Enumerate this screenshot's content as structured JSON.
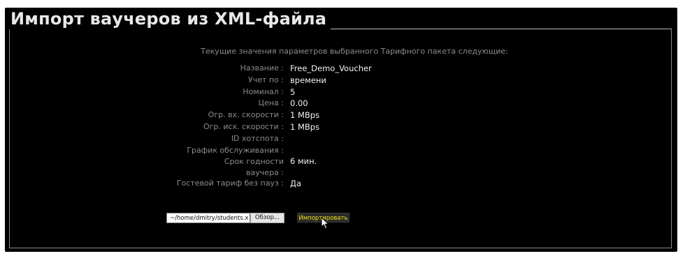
{
  "legend": "Импорт ваучеров из XML-файла",
  "intro": "Текущие значения параметров выбранного Тарифного пакета следующие:",
  "params": [
    {
      "label": "Название :",
      "value": "Free_Demo_Voucher"
    },
    {
      "label": "Учет по :",
      "value": "времени"
    },
    {
      "label": "Номинал :",
      "value": "5"
    },
    {
      "label": "Цена :",
      "value": "0.00"
    },
    {
      "label": "Огр. вх. скорости :",
      "value": "1 MBps"
    },
    {
      "label": "Огр. исх. скорости :",
      "value": "1 MBps"
    },
    {
      "label": "ID хотспота :",
      "value": ""
    },
    {
      "label": "График обслуживания :",
      "value": ""
    },
    {
      "label_line1": "Срок годности",
      "label_line2": "ваучера :",
      "value": "6 мин."
    },
    {
      "label": "Гостевой тариф без пауз :",
      "value": "Да"
    }
  ],
  "file": {
    "path": "~/home/dmitry/students.x",
    "browse_label": "Обзор..."
  },
  "import_label": "Импортировать",
  "colors": {
    "background": "#000000",
    "label": "#8c8c8c",
    "value": "#f2f2f2",
    "import_text": "#f1e312"
  },
  "icons": {
    "cursor": "mouse-pointer-icon"
  }
}
